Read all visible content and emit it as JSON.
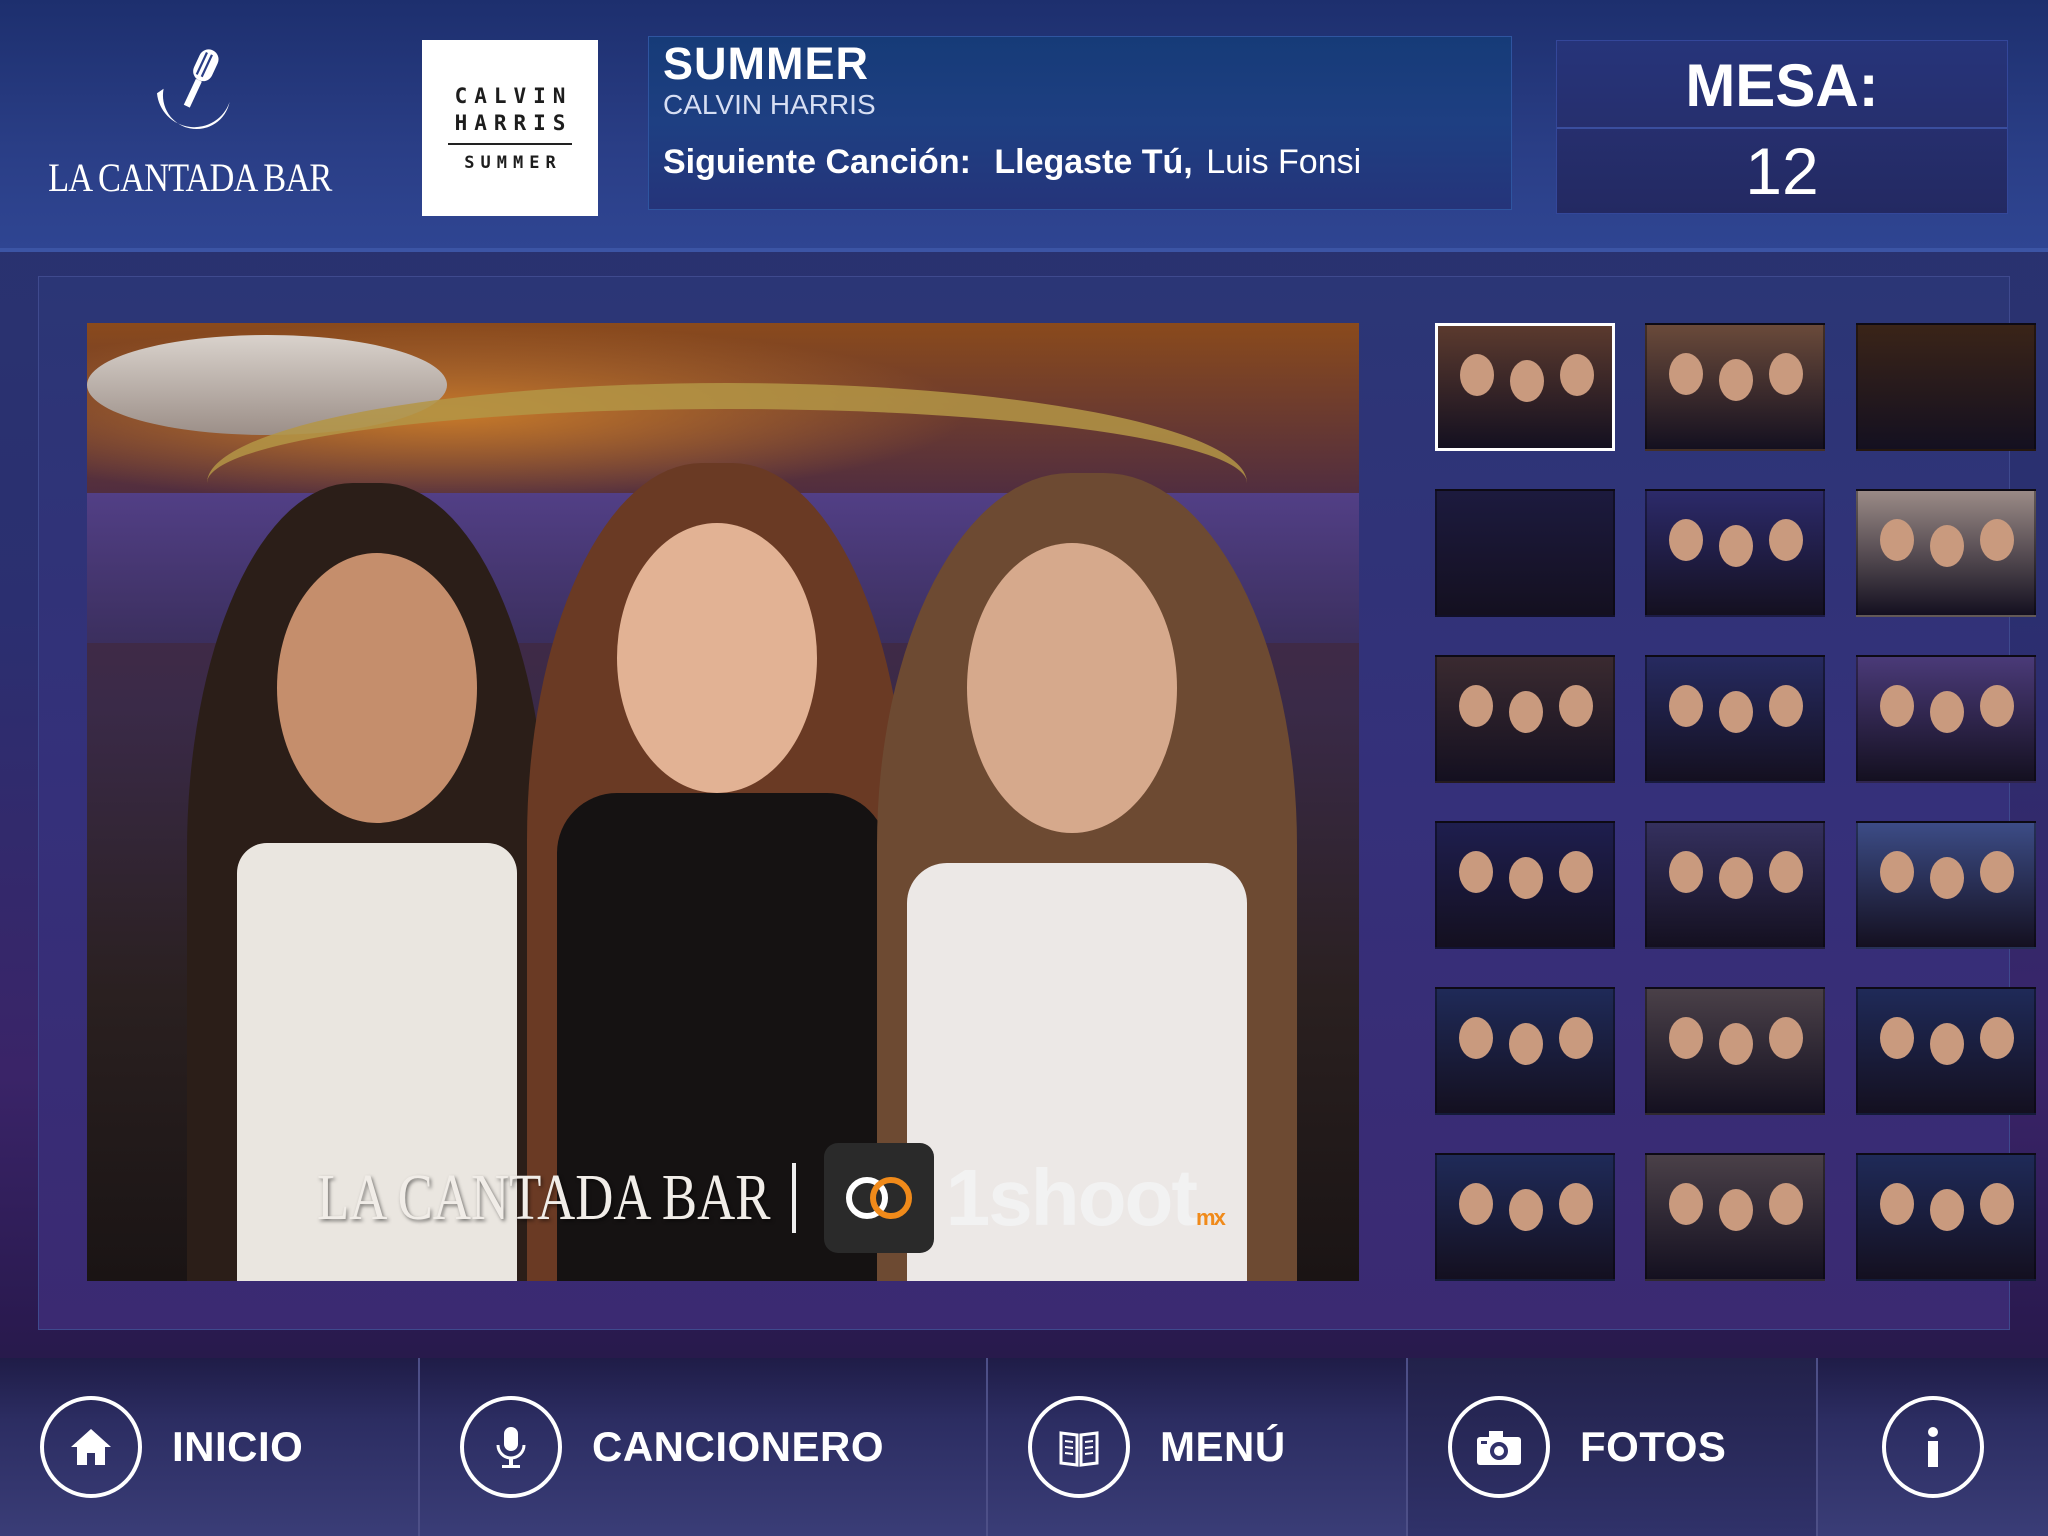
{
  "brand": {
    "name": "LA CANTADA BAR"
  },
  "album": {
    "line1": "CALVIN",
    "line2": "HARRIS",
    "line3": "SUMMER"
  },
  "now_playing": {
    "title": "SUMMER",
    "artist": "CALVIN HARRIS",
    "next_label": "Siguiente Canción:",
    "next_song": "Llegaste Tú,",
    "next_artist": "Luis Fonsi"
  },
  "table": {
    "label": "MESA:",
    "number": "12"
  },
  "photo": {
    "watermark_left": "LA CANTADA BAR",
    "watermark_right": "1shoot",
    "watermark_suffix": "mx"
  },
  "thumbnails": [
    {
      "selected": true,
      "scene": "three-girls",
      "tone": "#5b3a2e"
    },
    {
      "selected": false,
      "scene": "couple",
      "tone": "#6a4a3a"
    },
    {
      "selected": false,
      "scene": "bar-interior",
      "tone": "#3a2418"
    },
    {
      "selected": false,
      "scene": "bar-facade",
      "tone": "#1c1a3e"
    },
    {
      "selected": false,
      "scene": "crowd-purple",
      "tone": "#2c2a6a"
    },
    {
      "selected": false,
      "scene": "couple-light",
      "tone": "#9a8a86"
    },
    {
      "selected": false,
      "scene": "group-girls",
      "tone": "#3a2a30"
    },
    {
      "selected": false,
      "scene": "dance-floor",
      "tone": "#262a60"
    },
    {
      "selected": false,
      "scene": "group-purple",
      "tone": "#4a3a78"
    },
    {
      "selected": false,
      "scene": "group-blue",
      "tone": "#1e1e4e"
    },
    {
      "selected": false,
      "scene": "crowd-stage",
      "tone": "#34305e"
    },
    {
      "selected": false,
      "scene": "party-balloons",
      "tone": "#3c4c86"
    },
    {
      "selected": false,
      "scene": "group-blue",
      "tone": "#1f2a58"
    },
    {
      "selected": false,
      "scene": "group-friends",
      "tone": "#4a4048"
    },
    {
      "selected": false,
      "scene": "group-blue",
      "tone": "#1f2a58"
    },
    {
      "selected": false,
      "scene": "group-blue",
      "tone": "#1f2a58"
    },
    {
      "selected": false,
      "scene": "group-friends",
      "tone": "#4a4048"
    },
    {
      "selected": false,
      "scene": "group-blue",
      "tone": "#1f2a58"
    }
  ],
  "nav": [
    {
      "label": "INICIO",
      "icon": "home-icon",
      "active": false
    },
    {
      "label": "CANCIONERO",
      "icon": "microphone-icon",
      "active": false
    },
    {
      "label": "MENÚ",
      "icon": "book-icon",
      "active": false
    },
    {
      "label": "FOTOS",
      "icon": "camera-icon",
      "active": true
    },
    {
      "label": "",
      "icon": "info-icon",
      "active": false
    }
  ]
}
